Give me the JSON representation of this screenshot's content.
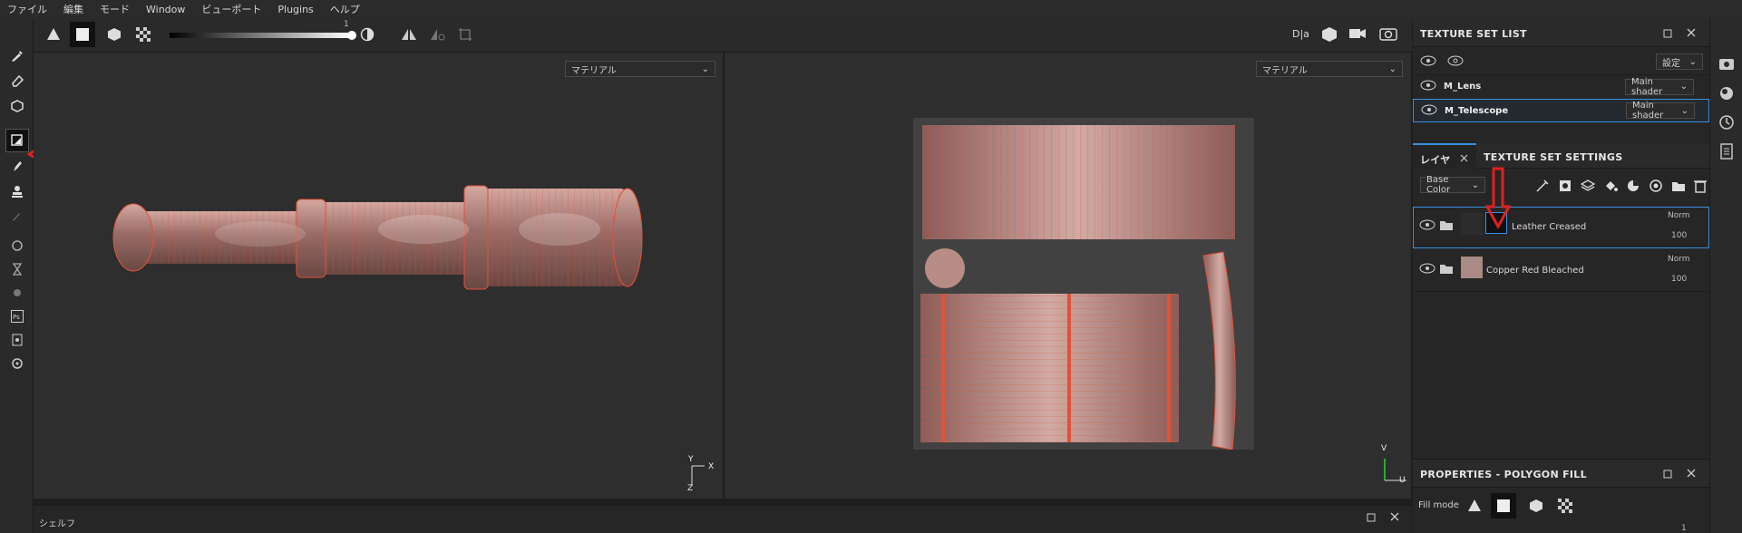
{
  "menu": [
    "ファイル",
    "編集",
    "モード",
    "Window",
    "ビューポート",
    "Plugins",
    "ヘルプ"
  ],
  "toolbar": {
    "slider_value": "1"
  },
  "viewports": {
    "left_select": "マテリアル",
    "right_select": "マテリアル",
    "axis_left": {
      "y": "Y",
      "x": "X",
      "z": "Z"
    },
    "axis_right": {
      "v": "V",
      "u": "U"
    }
  },
  "shelf": {
    "title": "シェルフ"
  },
  "texture_set_list": {
    "title": "TEXTURE SET LIST",
    "settings_label": "設定",
    "items": [
      {
        "name": "M_Lens",
        "shader": "Main shader"
      },
      {
        "name": "M_Telescope",
        "shader": "Main shader"
      }
    ]
  },
  "layers_panel": {
    "tab_layers": "レイヤ",
    "tab_settings": "TEXTURE SET SETTINGS",
    "channel": "Base Color",
    "layers": [
      {
        "name": "Leather Creased",
        "blend": "Norm",
        "opacity": "100"
      },
      {
        "name": "Copper Red Bleached",
        "blend": "Norm",
        "opacity": "100"
      }
    ]
  },
  "properties": {
    "title": "PROPERTIES - POLYGON FILL",
    "fill_mode_label": "Fill mode",
    "value": "1"
  },
  "colors": {
    "accent": "#3a8fe0",
    "annotation": "#e02020",
    "wire": "#e0523a"
  }
}
